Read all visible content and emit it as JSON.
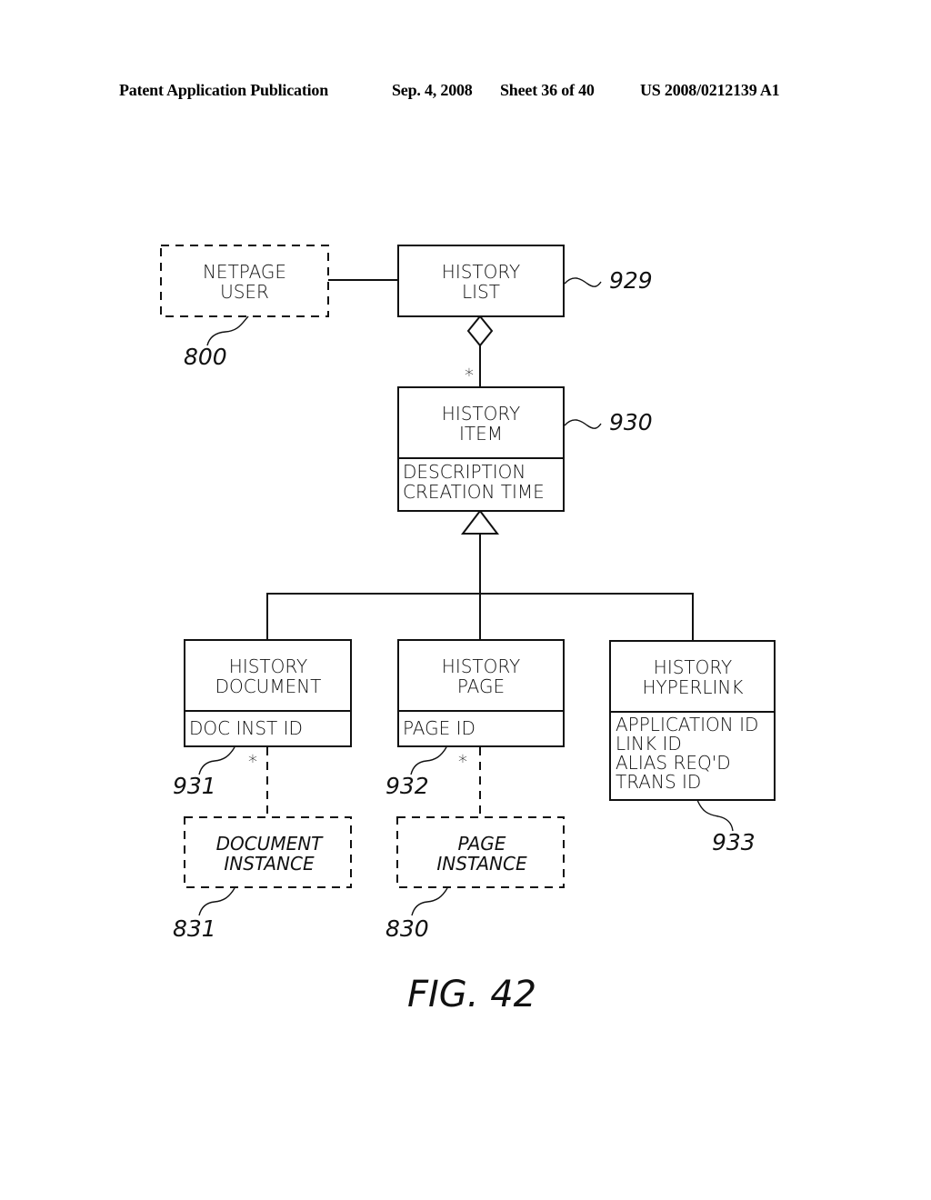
{
  "header": {
    "publication": "Patent Application Publication",
    "date": "Sep. 4, 2008",
    "sheet": "Sheet 36 of 40",
    "number": "US 2008/0212139 A1"
  },
  "figure_label": "FIG. 42",
  "classes": {
    "netpage_user": {
      "lines": [
        "NETPAGE",
        "USER"
      ],
      "ref": "800"
    },
    "history_list": {
      "lines": [
        "HISTORY",
        "LIST"
      ],
      "ref": "929"
    },
    "history_item": {
      "lines": [
        "HISTORY",
        "ITEM"
      ],
      "attributes": [
        "DESCRIPTION",
        "CREATION TIME"
      ],
      "ref": "930"
    },
    "history_document": {
      "lines": [
        "HISTORY",
        "DOCUMENT"
      ],
      "attributes": [
        "DOC INST ID"
      ],
      "ref": "931"
    },
    "history_page": {
      "lines": [
        "HISTORY",
        "PAGE"
      ],
      "attributes": [
        "PAGE ID"
      ],
      "ref": "932"
    },
    "history_hyperlink": {
      "lines": [
        "HISTORY",
        "HYPERLINK"
      ],
      "attributes": [
        "APPLICATION ID",
        "LINK ID",
        "ALIAS REQ'D",
        "TRANS ID"
      ],
      "ref": "933"
    },
    "document_instance": {
      "lines": [
        "DOCUMENT",
        "INSTANCE"
      ],
      "ref": "831"
    },
    "page_instance": {
      "lines": [
        "PAGE",
        "INSTANCE"
      ],
      "ref": "830"
    }
  },
  "multiplicities": {
    "list_to_item": "*",
    "document_to_instance": "*",
    "page_to_instance": "*"
  }
}
